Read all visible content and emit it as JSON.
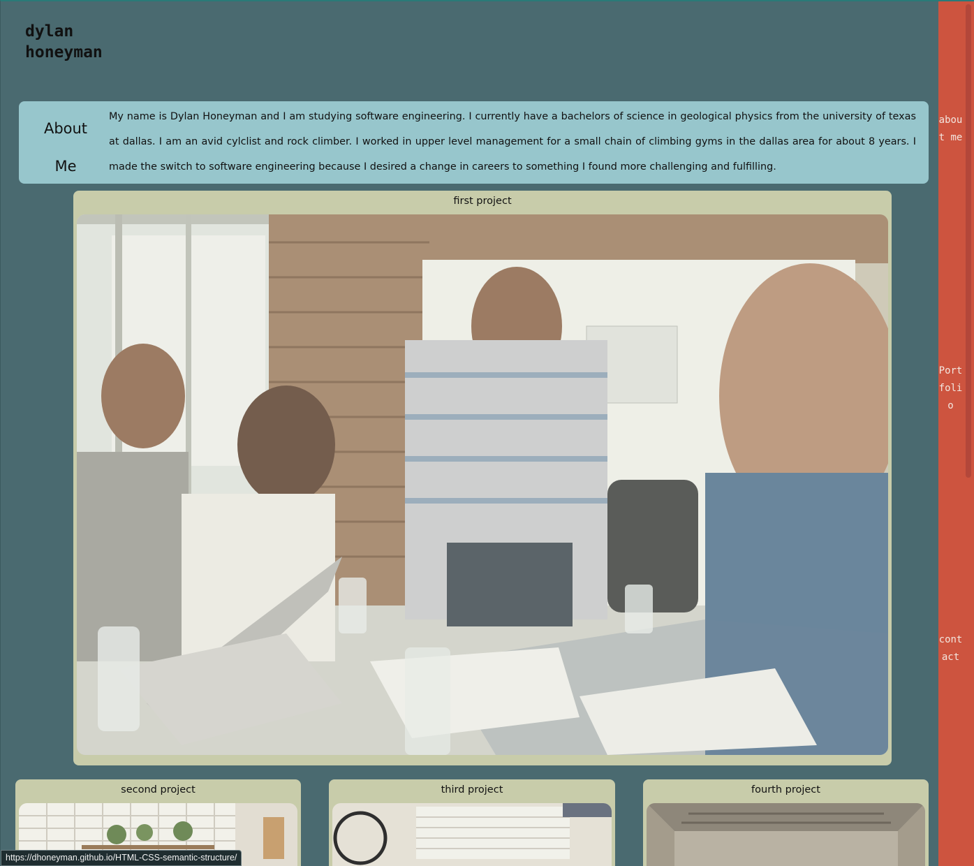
{
  "header": {
    "title_line1": "dylan",
    "title_line2": "honeyman"
  },
  "about": {
    "heading_line1": "About",
    "heading_line2": "Me",
    "text": "My name is Dylan Honeyman and I am studying software engineering. I currently have a bachelors of science in geological physics from the university of texas at dallas. I am an avid cylclist and rock climber. I worked in upper level management for a small chain of climbing gyms in the dallas area for about 8 years. I made the switch to software engineering because I desired a change in careers to something I found more challenging and fulfilling."
  },
  "projects": [
    {
      "title": "first project"
    },
    {
      "title": "second project"
    },
    {
      "title": "third project"
    },
    {
      "title": "fourth project"
    }
  ],
  "nav": {
    "about": "about me",
    "portfolio": "Portfolio",
    "contact": "contact"
  },
  "status_bar": {
    "url": "https://dhoneyman.github.io/HTML-CSS-semantic-structure/"
  },
  "colors": {
    "background": "#4a6a70",
    "about_bg": "#97c6cc",
    "card_bg": "#c8ccaa",
    "nav_bg": "#cd543f"
  }
}
